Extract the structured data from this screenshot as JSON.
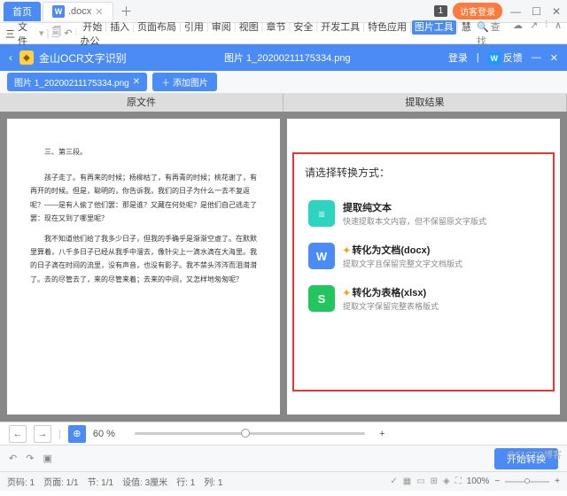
{
  "titlebar": {
    "home": "首页",
    "doc": ".docx",
    "badge": "1",
    "guest": "访客登录"
  },
  "ribbon": {
    "menu": "三",
    "file": "文件",
    "tabs": [
      "开始",
      "插入",
      "页面布局",
      "引用",
      "审阅",
      "视图",
      "章节",
      "安全",
      "开发工具",
      "特色应用",
      "图片工具",
      "慧办公"
    ],
    "active_index": 10,
    "search": "查找"
  },
  "ocrbar": {
    "title": "金山OCR文字识别",
    "filename": "图片 1_20200211175334.png",
    "login": "登录",
    "feedback": "反馈"
  },
  "tabs": {
    "img": "图片 1_20200211175334.png",
    "add": "添加图片"
  },
  "workspace": {
    "left_head": "原文件",
    "right_head": "提取结果",
    "doc_title": "三、第三段。",
    "doc_p1": "孩子走了。有再来的时候；杨柳枯了，有再青的时候；桃花谢了，有再开的时候。但是，聪明的，你告诉我，我们的日子为什么一去不复返呢？——是有人偷了他们罢：那是谁？又藏在何处呢？是他们自己逃走了罢：现在又到了哪里呢？",
    "doc_p2": "我不知道他们给了我多少日子，但我的手确乎是渐渐空虚了。在默默里算着，八千多日子已经从我手中溜去，像针尖上一滴水滴在大海里。我的日子滴在时间的流里，没有声音，也没有影子。我不禁头涔涔而泪潸潸了。去的尽管去了，来的尽管来着；去来的中间，又怎样地匆匆呢？"
  },
  "extract": {
    "prompt": "请选择转换方式：",
    "opts": [
      {
        "icon": "≡",
        "cls": "ic1",
        "title": "提取纯文本",
        "desc": "快速提取本文内容，但不保留原文字版式"
      },
      {
        "icon": "W",
        "cls": "ic2",
        "title": "转化为文档(docx)",
        "desc": "提取文字且保留完整文字文档版式",
        "k": true
      },
      {
        "icon": "S",
        "cls": "ic3",
        "title": "转化为表格(xlsx)",
        "desc": "提取文字保留完整表格版式",
        "k": true
      }
    ]
  },
  "zoom": {
    "pct": "60 %",
    "plus": "+"
  },
  "action": {
    "convert": "开始转换"
  },
  "status": {
    "page": "页码: 1",
    "pages": "页面: 1/1",
    "section": "节: 1/1",
    "setting": "设值: 3厘米",
    "line": "行: 1",
    "col": "列: 1",
    "zoom": "100%",
    "minus": "−",
    "plus": "+"
  },
  "watermark": "@51CTO博客"
}
